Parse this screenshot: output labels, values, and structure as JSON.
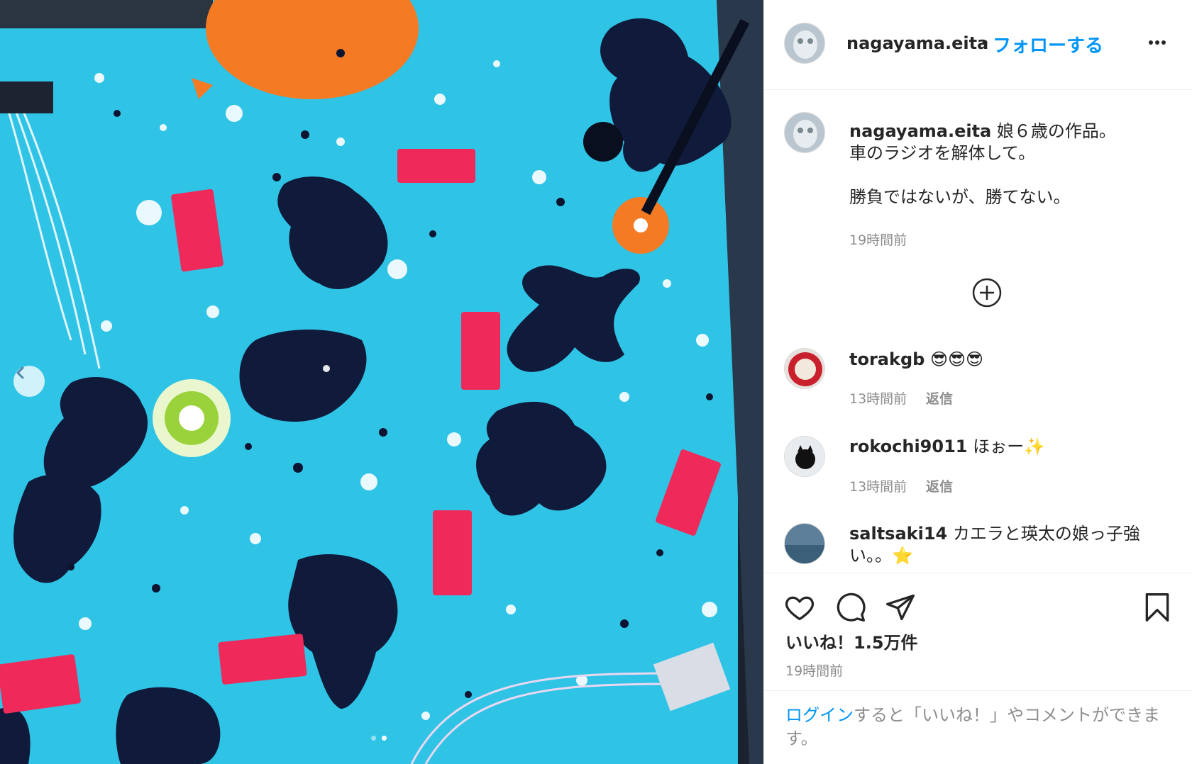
{
  "header": {
    "username": "nagayama.eita",
    "separator": "•",
    "follow_label": "フォローする",
    "more_icon": "more-dots-icon"
  },
  "caption": {
    "username": "nagayama.eita",
    "text": "娘６歳の作品。\n車のラジオを解体して。\n\n勝負ではないが、勝てない。",
    "time": "19時間前"
  },
  "comments": [
    {
      "username": "torakgb",
      "text": "😎😎😎",
      "time": "13時間前",
      "reply_label": "返信"
    },
    {
      "username": "rokochi9011",
      "text": "ほぉー✨",
      "time": "13時間前",
      "reply_label": "返信"
    },
    {
      "username": "saltsaki14",
      "text": "カエラと瑛太の娘っ子強い。。⭐️",
      "time": "",
      "reply_label": ""
    }
  ],
  "actions": {
    "like_icon": "heart-icon",
    "comment_icon": "comment-bubble-icon",
    "share_icon": "paper-plane-icon",
    "save_icon": "bookmark-icon"
  },
  "likes_label": "いいね！1.5万件",
  "post_time": "19時間前",
  "login": {
    "link_label": "ログイン",
    "rest_text": "すると「いいね！」やコメントができます。"
  },
  "carousel": {
    "total": 2,
    "active_index": 1,
    "prev_icon": "chevron-left-icon"
  }
}
